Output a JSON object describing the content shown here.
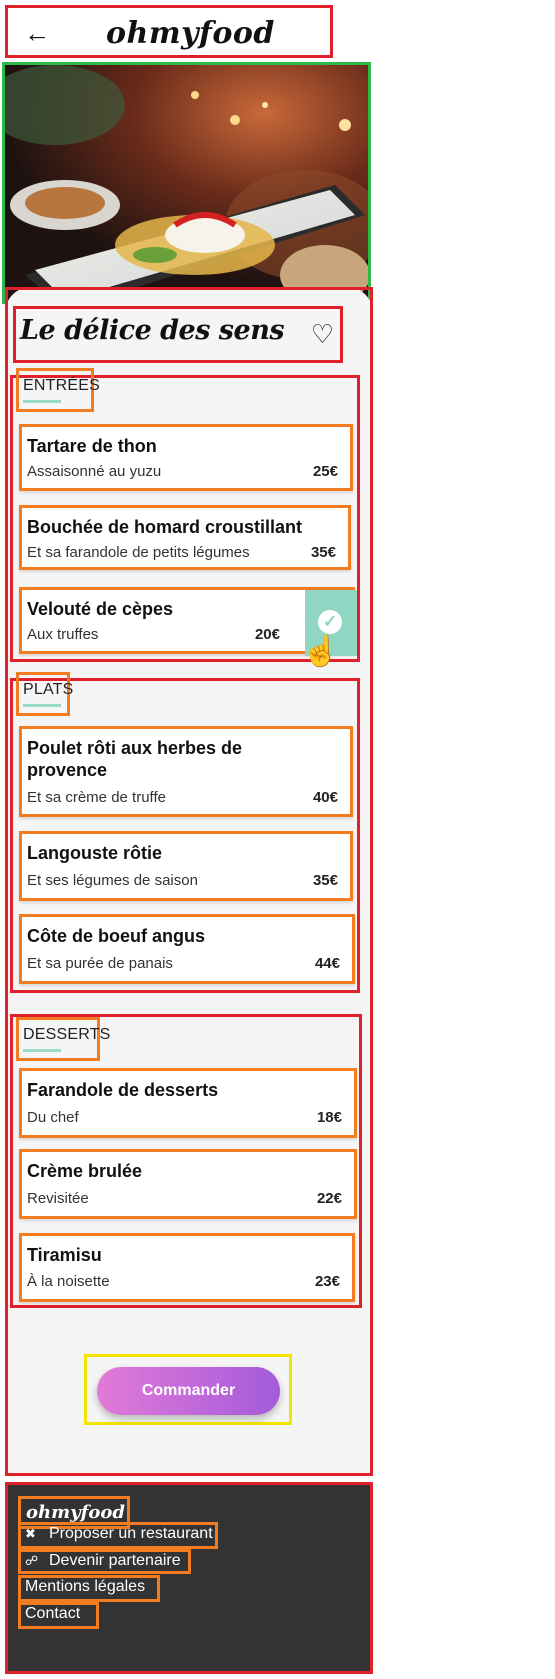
{
  "header": {
    "back_icon": "arrow-left-icon",
    "logo": "ohmyfood"
  },
  "restaurant": {
    "name": "Le délice des sens",
    "favorite_icon": "heart-outline-icon"
  },
  "sections": [
    {
      "title": "ENTRÉES",
      "dishes": [
        {
          "name": "Tartare de thon",
          "description": "Assaisonné au yuzu",
          "price": "25€"
        },
        {
          "name": "Bouchée de homard croustillant",
          "description": "Et sa farandole de petits légumes",
          "price": "35€"
        },
        {
          "name": "Velouté de cèpes",
          "description": "Aux truffes",
          "price": "20€",
          "selected": true
        }
      ]
    },
    {
      "title": "PLATS",
      "dishes": [
        {
          "name": "Poulet rôti aux herbes de provence",
          "description": "Et sa crème de truffe",
          "price": "40€"
        },
        {
          "name": "Langouste rôtie",
          "description": "Et ses légumes de saison",
          "price": "35€"
        },
        {
          "name": "Côte de boeuf angus",
          "description": "Et sa purée de panais",
          "price": "44€"
        }
      ]
    },
    {
      "title": "DESSERTS",
      "dishes": [
        {
          "name": "Farandole de desserts",
          "description": "Du chef",
          "price": "18€"
        },
        {
          "name": "Crème brulée",
          "description": "Revisitée",
          "price": "22€"
        },
        {
          "name": "Tiramisu",
          "description": "À la noisette",
          "price": "23€"
        }
      ]
    }
  ],
  "order_button": "Commander",
  "footer": {
    "logo": "ohmyfood",
    "links": [
      {
        "label": "Proposer un restaurant",
        "icon": "utensils-icon"
      },
      {
        "label": "Devenir partenaire",
        "icon": "handshake-icon"
      },
      {
        "label": "Mentions légales"
      },
      {
        "label": "Contact"
      }
    ]
  },
  "colors": {
    "accent": "#9ad9c8",
    "button_start": "#e27ad7",
    "button_end": "#a35bdb",
    "footer_bg": "#333333"
  }
}
